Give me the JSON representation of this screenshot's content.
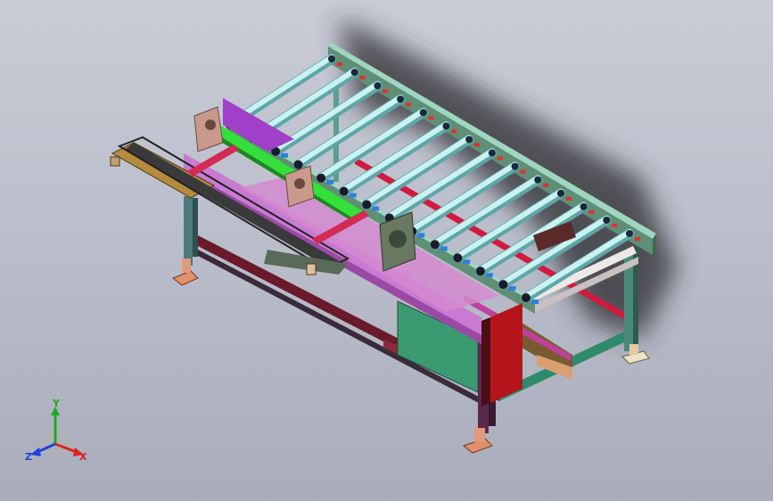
{
  "window": {
    "type": "cad-3d-viewport"
  },
  "model": {
    "description_tags": [
      "roller-conveyor",
      "frame",
      "shaft",
      "guide-rails",
      "support-feet"
    ],
    "roller_count": 14,
    "colors": {
      "background_top": "#c9ccd6",
      "background_bottom": "#a9adbb",
      "roller": "#c9f2f0",
      "side_rail": "#6f9a7e",
      "frame": "#2f8a6c",
      "leg": "#5a7f78",
      "guide": "#b06fd0",
      "shaft": "#33e03a",
      "red_panel": "#b3151a",
      "plate": "#b68a3f",
      "bracket": "#c99a8c",
      "pink_bar": "#d32b55"
    }
  },
  "triad": {
    "x_label": "X",
    "y_label": "Y",
    "z_label": "Z",
    "x_color": "#e02020",
    "y_color": "#1fa81f",
    "z_color": "#2040e0"
  }
}
